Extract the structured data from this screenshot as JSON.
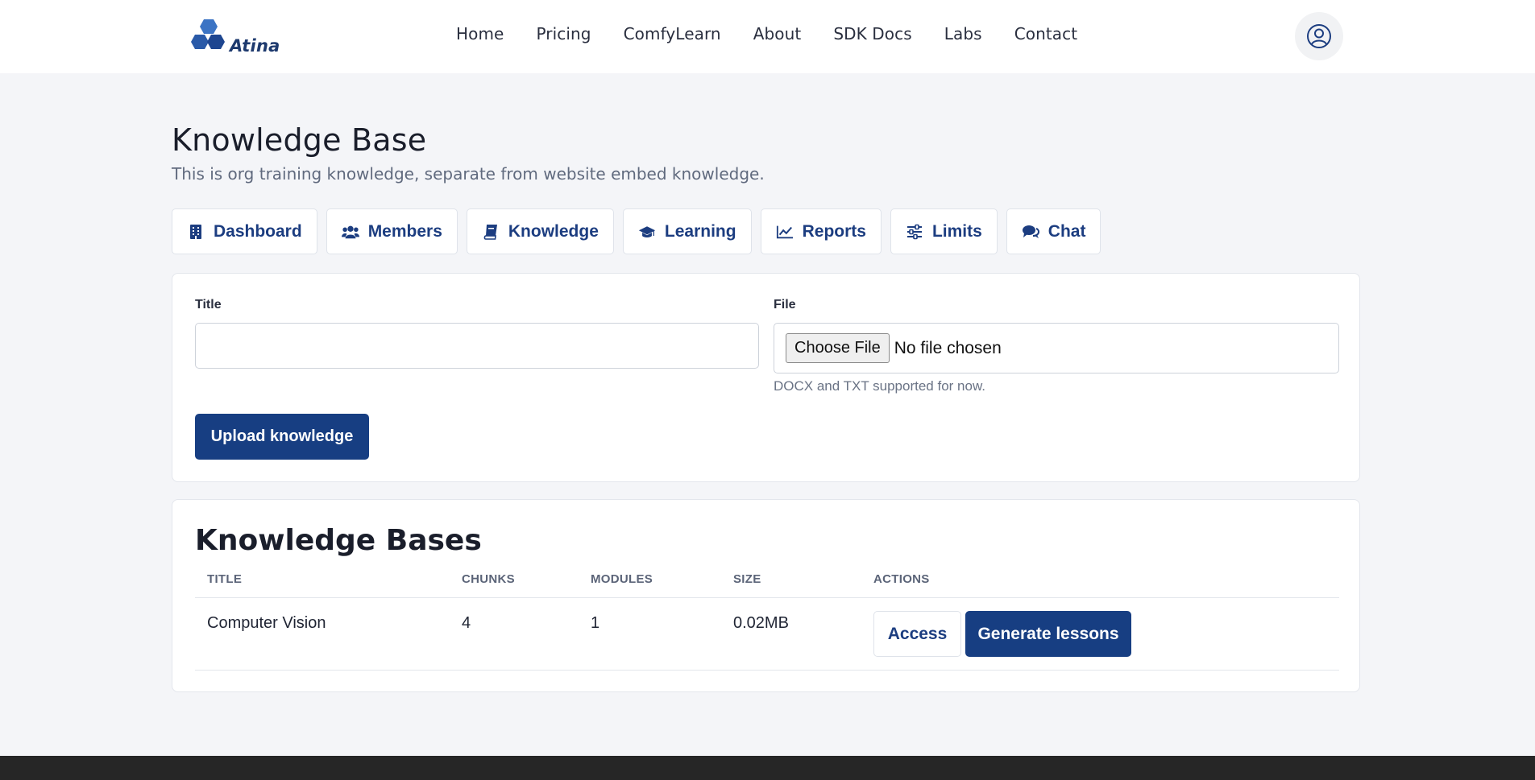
{
  "header": {
    "logo_text": "Atina",
    "nav": [
      "Home",
      "Pricing",
      "ComfyLearn",
      "About",
      "SDK Docs",
      "Labs",
      "Contact"
    ]
  },
  "page": {
    "title": "Knowledge Base",
    "subtitle": "This is org training knowledge, separate from website embed knowledge."
  },
  "tabs": [
    {
      "label": "Dashboard",
      "icon": "building-icon"
    },
    {
      "label": "Members",
      "icon": "users-icon"
    },
    {
      "label": "Knowledge",
      "icon": "book-icon"
    },
    {
      "label": "Learning",
      "icon": "graduation-cap-icon"
    },
    {
      "label": "Reports",
      "icon": "line-chart-icon"
    },
    {
      "label": "Limits",
      "icon": "sliders-icon"
    },
    {
      "label": "Chat",
      "icon": "comments-icon"
    }
  ],
  "upload_form": {
    "title_label": "Title",
    "title_value": "",
    "file_label": "File",
    "choose_file_label": "Choose File",
    "no_file_text": "No file chosen",
    "help_text": "DOCX and TXT supported for now.",
    "submit_label": "Upload knowledge"
  },
  "knowledge_bases": {
    "title": "Knowledge Bases",
    "columns": [
      "TITLE",
      "CHUNKS",
      "MODULES",
      "SIZE",
      "ACTIONS"
    ],
    "rows": [
      {
        "title": "Computer Vision",
        "chunks": "4",
        "modules": "1",
        "size": "0.02MB",
        "access_label": "Access",
        "generate_label": "Generate lessons"
      }
    ]
  },
  "colors": {
    "primary": "#173e82",
    "tab_text": "#1c3d80",
    "background": "#f4f5f8",
    "footer": "#262626"
  }
}
